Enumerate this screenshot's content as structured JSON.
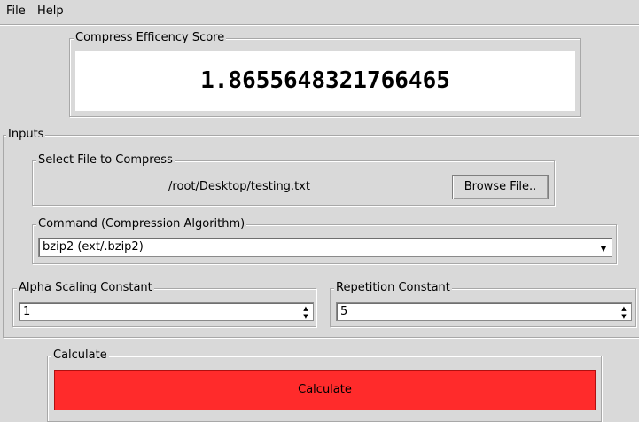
{
  "menu": {
    "file": "File",
    "help": "Help"
  },
  "score": {
    "label": "Compress Efficency Score",
    "value": "1.8655648321766465"
  },
  "inputs": {
    "label": "Inputs",
    "file": {
      "label": "Select File to Compress",
      "path": "/root/Desktop/testing.txt",
      "browse_button": "Browse File.."
    },
    "command": {
      "label": "Command (Compression Algorithm)",
      "value": "bzip2 (ext/.bzip2)",
      "icon": "chevron-down-icon"
    },
    "alpha": {
      "label": "Alpha Scaling Constant",
      "value": "1"
    },
    "repetition": {
      "label": "Repetition Constant",
      "value": "5"
    }
  },
  "calculate": {
    "label": "Calculate",
    "button": "Calculate"
  },
  "colors": {
    "calculate_button": "#ff2b2b",
    "background": "#d9d9d9"
  }
}
